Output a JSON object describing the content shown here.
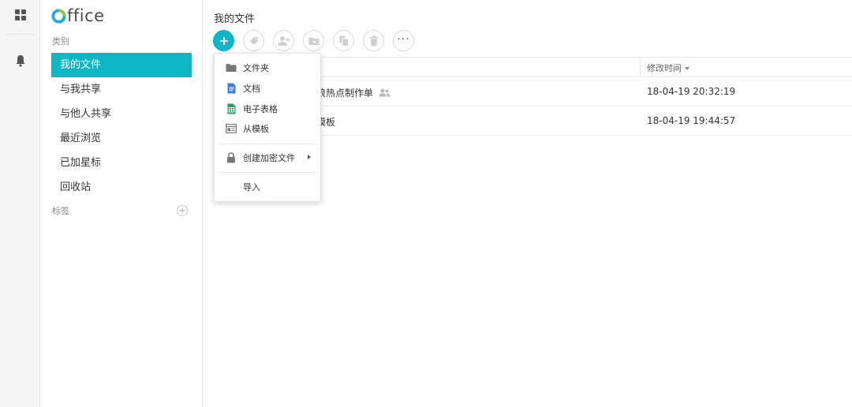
{
  "app": {
    "logo_rest": "ffice",
    "brand_color": "#0fb6c6"
  },
  "sidebar": {
    "category_label": "类别",
    "items": [
      {
        "label": "我的文件",
        "active": true
      },
      {
        "label": "与我共享"
      },
      {
        "label": "与他人共享"
      },
      {
        "label": "最近浏览"
      },
      {
        "label": "已加星标"
      },
      {
        "label": "回收站"
      }
    ],
    "tags_label": "标签"
  },
  "main": {
    "title": "我的文件",
    "toolbar": [
      "add-icon",
      "tag-icon",
      "share-user-icon",
      "move-folder-icon",
      "copy-icon",
      "delete-icon",
      "more-icon"
    ],
    "more_label": "···",
    "column_modified": "修改时间",
    "rows": [
      {
        "name": "浪热点制作单",
        "modified": "18-04-19 20:32:19"
      },
      {
        "name": "模板",
        "modified": "18-04-19 19:44:57"
      }
    ]
  },
  "menu": {
    "items": [
      {
        "label": "文件夹",
        "icon": "folder-icon"
      },
      {
        "label": "文档",
        "icon": "document-icon"
      },
      {
        "label": "电子表格",
        "icon": "spreadsheet-icon"
      },
      {
        "label": "从模板",
        "icon": "template-icon"
      },
      {
        "label": "创建加密文件",
        "icon": "lock-icon"
      },
      {
        "label": "导入"
      }
    ]
  }
}
